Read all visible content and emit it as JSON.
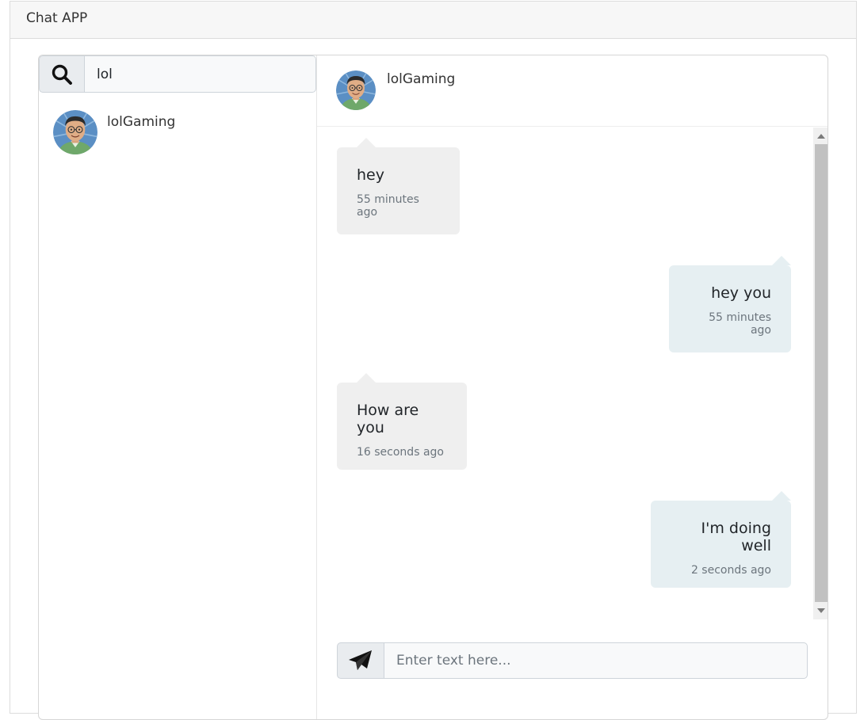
{
  "app": {
    "title": "Chat APP"
  },
  "search": {
    "value": "lol",
    "icon": "search-icon"
  },
  "contacts": [
    {
      "name": "lolGaming"
    }
  ],
  "chat": {
    "header_name": "lolGaming",
    "messages": [
      {
        "text": "hey",
        "time": "55 minutes ago",
        "direction": "received"
      },
      {
        "text": "hey you",
        "time": "55 minutes ago",
        "direction": "sent"
      },
      {
        "text": "How are you",
        "time": "16 seconds ago",
        "direction": "received"
      },
      {
        "text": "I'm doing well",
        "time": "2 seconds ago",
        "direction": "sent"
      }
    ]
  },
  "composer": {
    "placeholder": "Enter text here...",
    "icon": "send-icon"
  },
  "colors": {
    "received_bubble": "#efefef",
    "sent_bubble": "#e6eff2",
    "header_bg": "#f7f7f7"
  }
}
